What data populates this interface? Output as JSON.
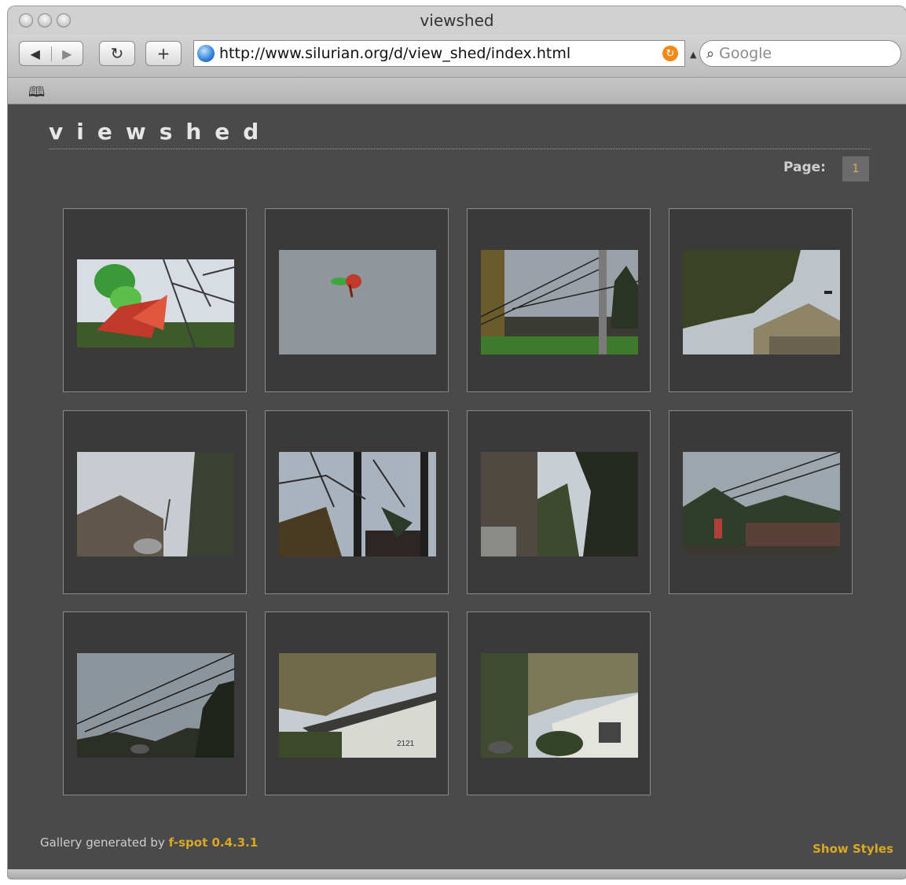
{
  "window": {
    "title": "viewshed"
  },
  "toolbar": {
    "back_glyph": "◀",
    "forward_glyph": "▶",
    "reload_glyph": "↻",
    "add_glyph": "+",
    "url": "http://www.silurian.org/d/view_shed/index.html",
    "search_placeholder": "Google"
  },
  "bookmarks": {
    "icon": "book-icon"
  },
  "gallery": {
    "title": "viewshed",
    "page_label": "Page:",
    "current_page": "1",
    "footer_prefix": "Gallery generated by",
    "footer_link": "f-spot 0.4.3.1",
    "show_styles": "Show Styles",
    "thumbnails": [
      {
        "subject": "balloons against sky with bare branches"
      },
      {
        "subject": "balloon floating in grey sky"
      },
      {
        "subject": "street with utility pole and power lines"
      },
      {
        "subject": "tree over house roof"
      },
      {
        "subject": "garage roof and evergreen tree"
      },
      {
        "subject": "bare trees and rooftop"
      },
      {
        "subject": "house corner and trees"
      },
      {
        "subject": "power lines over building"
      },
      {
        "subject": "power lines over street"
      },
      {
        "subject": "house with number 2121 under trees"
      },
      {
        "subject": "white house with shrubs"
      }
    ]
  },
  "colors": {
    "page_background": "#4a4a4a",
    "accent_link": "#d9a824"
  }
}
